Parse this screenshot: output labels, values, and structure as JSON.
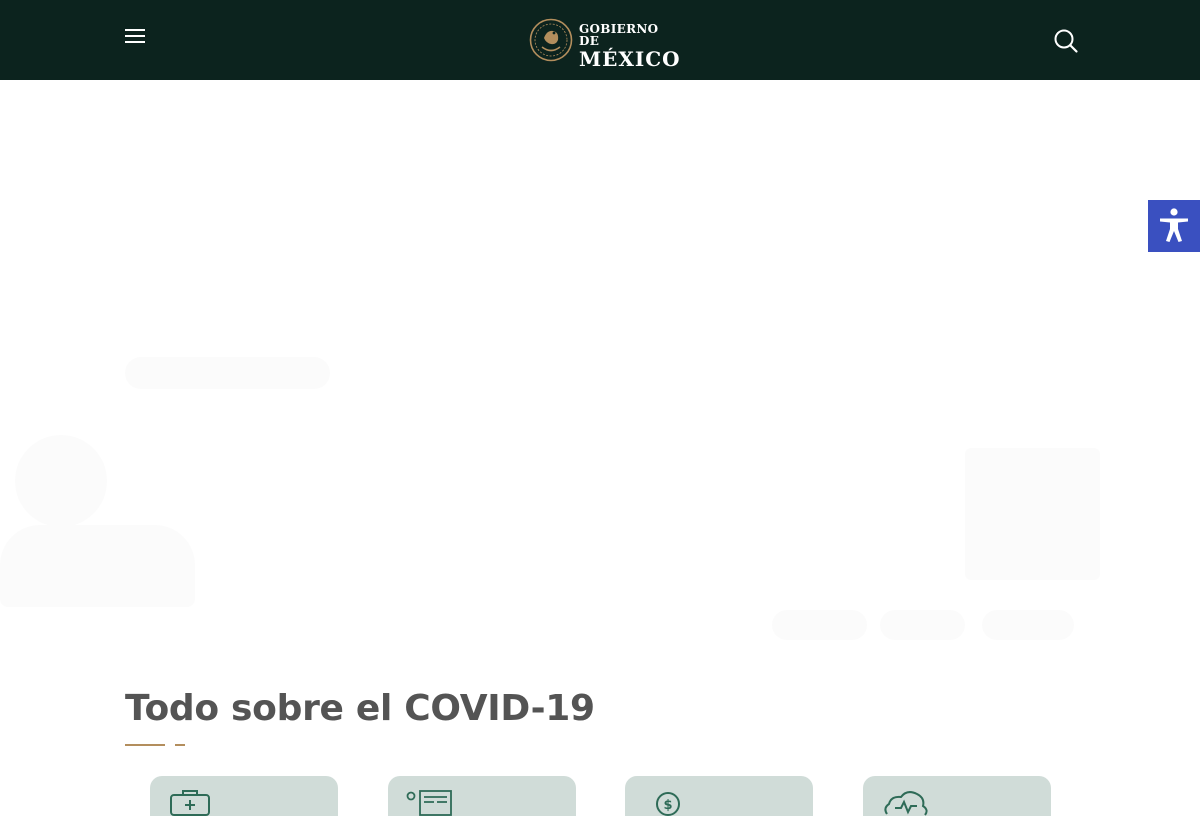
{
  "header": {
    "logo_line1": "GOBIERNO DE",
    "logo_line2": "MÉXICO",
    "menu_icon": "hamburger-menu-icon",
    "search_icon": "search-icon"
  },
  "accessibility": {
    "icon": "universal-access-icon",
    "color": "#3a50c0"
  },
  "section": {
    "title": "Todo sobre el COVID-19"
  },
  "cards": [
    {
      "icon": "medical-kit-icon"
    },
    {
      "icon": "news-article-icon"
    },
    {
      "icon": "money-icon"
    },
    {
      "icon": "cloud-vital-icon"
    }
  ],
  "colors": {
    "header_bg": "#0c231e",
    "accent_gold": "#b38e5d",
    "card_bg": "#d0dcd8",
    "title": "#545454"
  }
}
